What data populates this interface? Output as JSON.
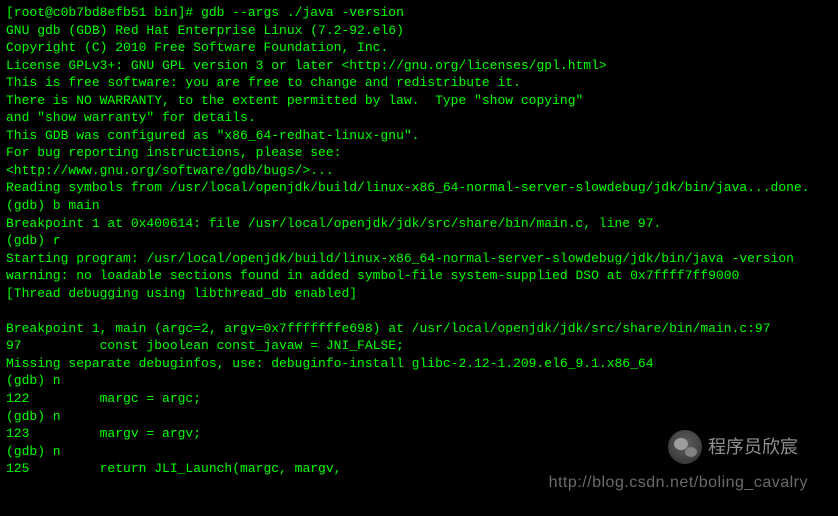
{
  "terminal": {
    "lines": [
      "[root@c0b7bd8efb51 bin]# gdb --args ./java -version",
      "GNU gdb (GDB) Red Hat Enterprise Linux (7.2-92.el6)",
      "Copyright (C) 2010 Free Software Foundation, Inc.",
      "License GPLv3+: GNU GPL version 3 or later <http://gnu.org/licenses/gpl.html>",
      "This is free software: you are free to change and redistribute it.",
      "There is NO WARRANTY, to the extent permitted by law.  Type \"show copying\"",
      "and \"show warranty\" for details.",
      "This GDB was configured as \"x86_64-redhat-linux-gnu\".",
      "For bug reporting instructions, please see:",
      "<http://www.gnu.org/software/gdb/bugs/>...",
      "Reading symbols from /usr/local/openjdk/build/linux-x86_64-normal-server-slowdebug/jdk/bin/java...done.",
      "(gdb) b main",
      "Breakpoint 1 at 0x400614: file /usr/local/openjdk/jdk/src/share/bin/main.c, line 97.",
      "(gdb) r",
      "Starting program: /usr/local/openjdk/build/linux-x86_64-normal-server-slowdebug/jdk/bin/java -version",
      "warning: no loadable sections found in added symbol-file system-supplied DSO at 0x7ffff7ff9000",
      "[Thread debugging using libthread_db enabled]",
      "",
      "Breakpoint 1, main (argc=2, argv=0x7fffffffe698) at /usr/local/openjdk/jdk/src/share/bin/main.c:97",
      "97          const jboolean const_javaw = JNI_FALSE;",
      "Missing separate debuginfos, use: debuginfo-install glibc-2.12-1.209.el6_9.1.x86_64",
      "(gdb) n",
      "122         margc = argc;",
      "(gdb) n",
      "123         margv = argv;",
      "(gdb) n",
      "125         return JLI_Launch(margc, margv,"
    ]
  },
  "watermark": {
    "author": "程序员欣宸",
    "url": "http://blog.csdn.net/boling_cavalry"
  }
}
